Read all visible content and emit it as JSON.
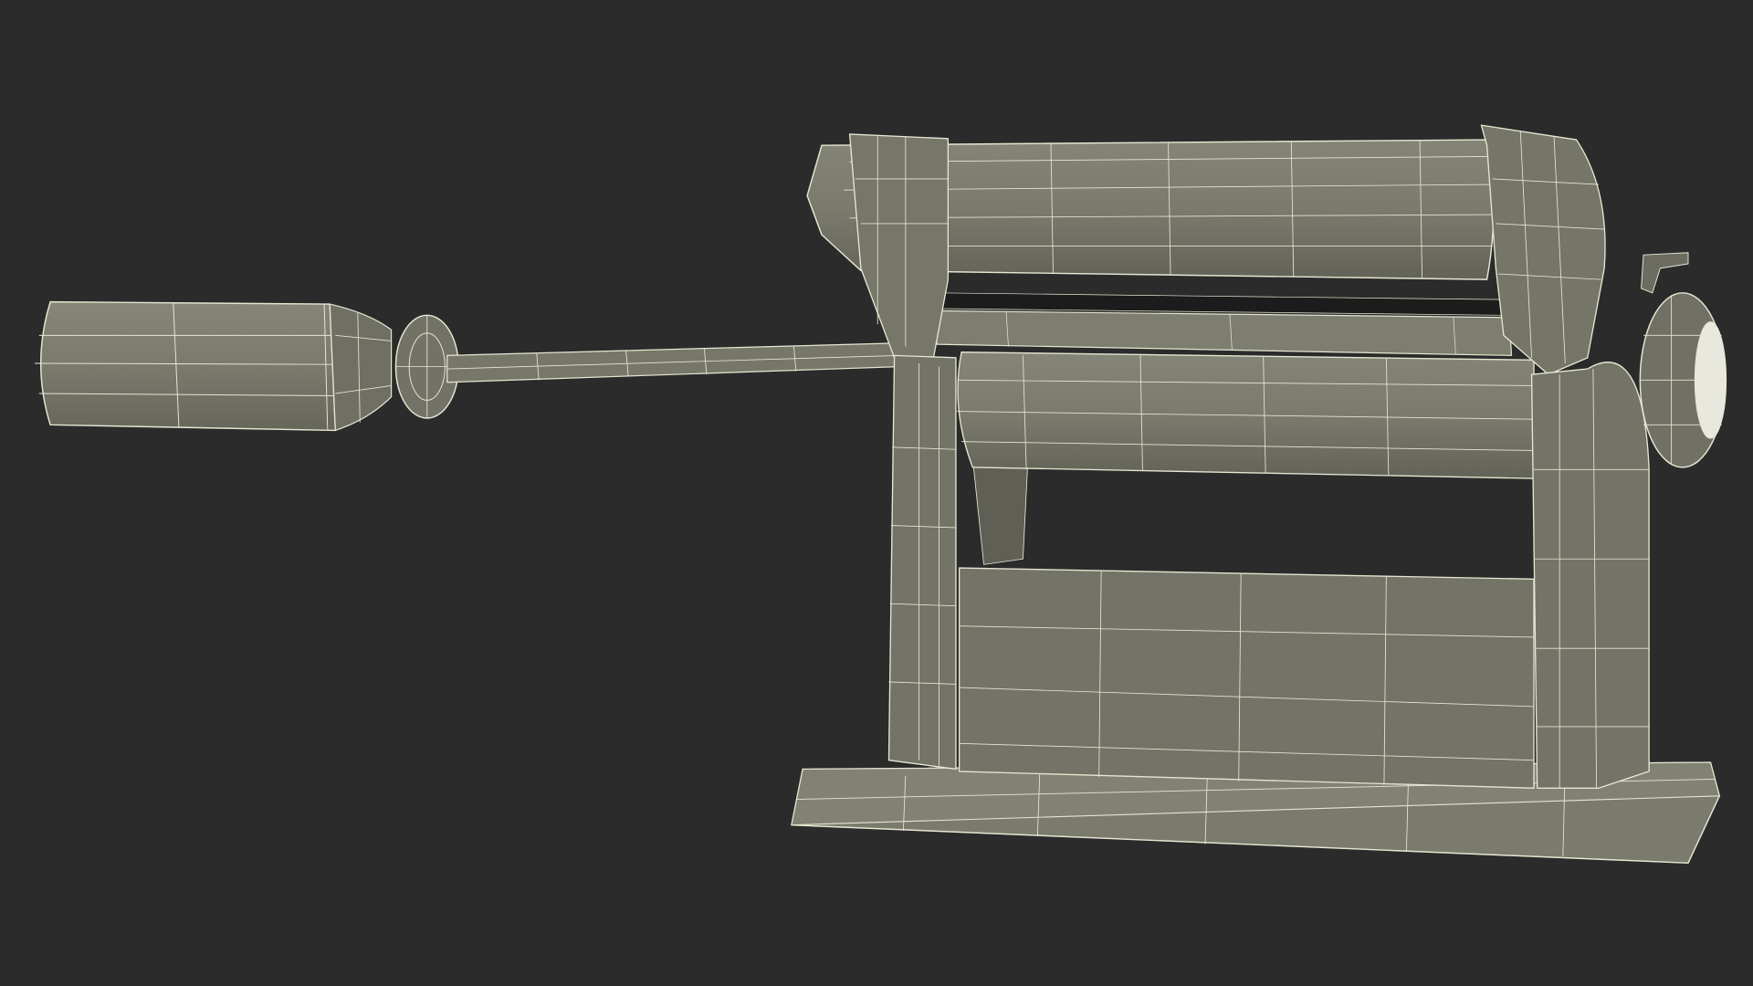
{
  "scene": {
    "background_color": "#2b2b2b",
    "mesh_fill_color": "#7a7a6d",
    "mesh_shade_color": "#6b6b60",
    "mesh_dark_color": "#55554c",
    "wire_color": "#e6e6d2",
    "slot_color": "#1c1c1c"
  }
}
